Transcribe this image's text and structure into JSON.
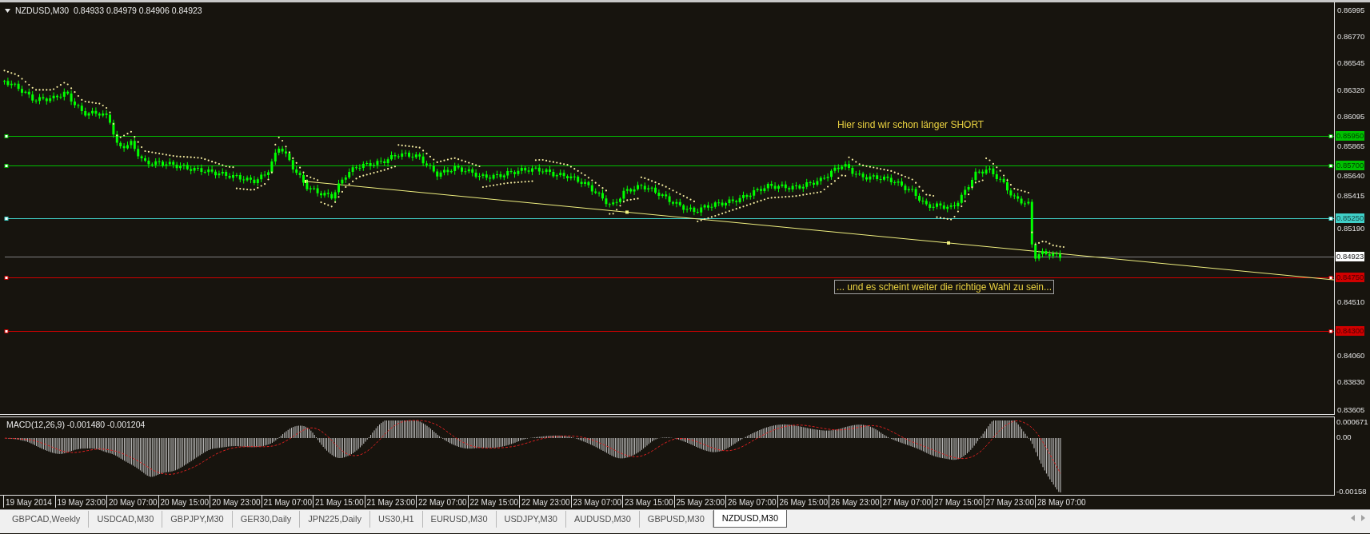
{
  "chart": {
    "symbol": "NZDUSD,M30",
    "quotes": "0.84933 0.84979 0.84906 0.84923",
    "price_axis": [
      "0.86995",
      "0.86770",
      "0.86545",
      "0.86320",
      "0.86095",
      "0.85865",
      "0.85640",
      "0.85415",
      "0.85190",
      "0.84510",
      "0.84060",
      "0.83830",
      "0.83605"
    ],
    "levels": [
      {
        "kind": "line",
        "label": "0.85950",
        "color": "#00c000"
      },
      {
        "kind": "line",
        "label": "0.85700",
        "color": "#00c000"
      },
      {
        "kind": "line",
        "label": "0.85250",
        "color": "#40d0c8"
      },
      {
        "kind": "bid",
        "label": "0.84923",
        "color": "#ffffff"
      },
      {
        "kind": "line",
        "label": "0.84750",
        "color": "#d00000"
      },
      {
        "kind": "line",
        "label": "0.84300",
        "color": "#d00000"
      }
    ],
    "annotations": [
      {
        "kind": "label",
        "text": "Hier sind wir schon länger SHORT"
      },
      {
        "kind": "text",
        "text": "... und es scheint weiter die richtige Wahl zu sein..."
      }
    ]
  },
  "indicator": {
    "label": "MACD(12,26,9) -0.001480 -0.001204",
    "axis": [
      "0.000671",
      "0.00",
      "-0.00158"
    ]
  },
  "time_axis": [
    "19 May 2014",
    "19 May 23:00",
    "20 May 07:00",
    "20 May 15:00",
    "20 May 23:00",
    "21 May 07:00",
    "21 May 15:00",
    "21 May 23:00",
    "22 May 07:00",
    "22 May 15:00",
    "22 May 23:00",
    "23 May 07:00",
    "23 May 15:00",
    "25 May 23:00",
    "26 May 07:00",
    "26 May 15:00",
    "26 May 23:00",
    "27 May 07:00",
    "27 May 15:00",
    "27 May 23:00",
    "28 May 07:00"
  ],
  "tabs": [
    {
      "label": "GBPCAD,Weekly",
      "selected": false
    },
    {
      "label": "USDCAD,M30",
      "selected": false
    },
    {
      "label": "GBPJPY,M30",
      "selected": false
    },
    {
      "label": "GER30,Daily",
      "selected": false
    },
    {
      "label": "JPN225,Daily",
      "selected": false
    },
    {
      "label": "US30,H1",
      "selected": false
    },
    {
      "label": "EURUSD,M30",
      "selected": false
    },
    {
      "label": "USDJPY,M30",
      "selected": false
    },
    {
      "label": "AUDUSD,M30",
      "selected": false
    },
    {
      "label": "GBPUSD,M30",
      "selected": false
    },
    {
      "label": "NZDUSD,M30",
      "selected": true
    }
  ]
}
